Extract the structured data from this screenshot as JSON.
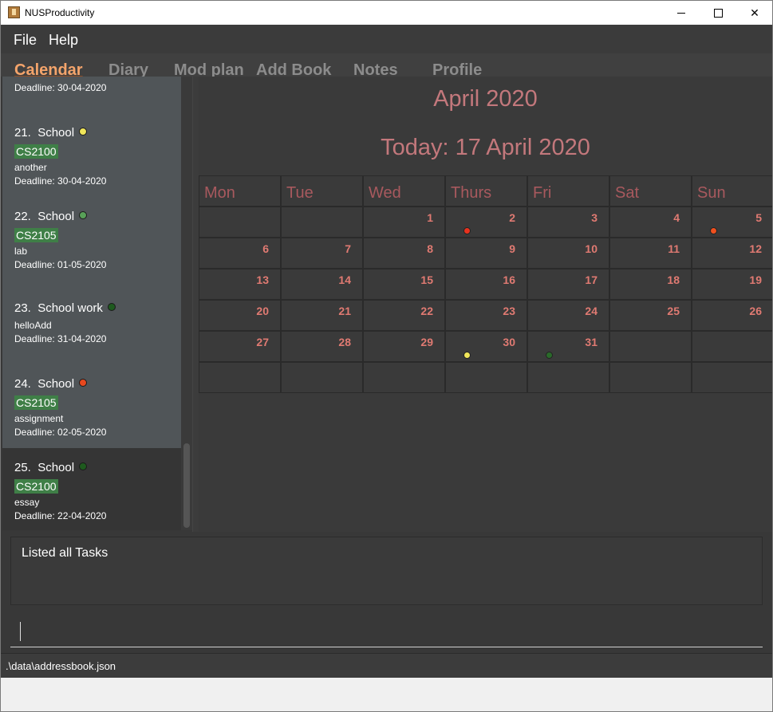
{
  "window": {
    "title": "NUSProductivity"
  },
  "menu": {
    "file": "File",
    "help": "Help"
  },
  "tabs": [
    "Calendar",
    "Diary",
    "Mod plan",
    "Add Book",
    "Notes",
    "Profile"
  ],
  "tasks": [
    {
      "partial_text": "Deadline: 30-04-2020"
    },
    {
      "index": "21.",
      "type": "School",
      "status_color": "#f0e65a",
      "module": "CS2100",
      "description": "another",
      "deadline": "Deadline: 30-04-2020"
    },
    {
      "index": "22.",
      "type": "School",
      "status_color": "#58a058",
      "module": "CS2105",
      "description": "lab",
      "deadline": "Deadline: 01-05-2020"
    },
    {
      "index": "23.",
      "type": "School work",
      "status_color": "#1e5a1e",
      "module": "",
      "description": "helloAdd",
      "deadline": "Deadline: 31-04-2020"
    },
    {
      "index": "24.",
      "type": "School",
      "status_color": "#e8481e",
      "module": "CS2105",
      "description": "assignment",
      "deadline": "Deadline: 02-05-2020"
    },
    {
      "index": "25.",
      "type": "School",
      "status_color": "#1e5a1e",
      "module": "CS2100",
      "description": "essay",
      "deadline": "Deadline: 22-04-2020"
    }
  ],
  "calendar": {
    "month_title": "April 2020",
    "today": "Today: 17 April 2020",
    "weekdays": [
      "Mon",
      "Tue",
      "Wed",
      "Thurs",
      "Fri",
      "Sat",
      "Sun"
    ],
    "weeks": [
      [
        "",
        "",
        "1",
        "2",
        "3",
        "4",
        "5"
      ],
      [
        "6",
        "7",
        "8",
        "9",
        "10",
        "11",
        "12"
      ],
      [
        "13",
        "14",
        "15",
        "16",
        "17",
        "18",
        "19"
      ],
      [
        "20",
        "21",
        "22",
        "23",
        "24",
        "25",
        "26"
      ],
      [
        "27",
        "28",
        "29",
        "30",
        "31",
        "",
        ""
      ],
      [
        "",
        "",
        "",
        "",
        "",
        "",
        ""
      ]
    ],
    "markers": [
      {
        "week": 0,
        "day": 3,
        "color": "#e8321e"
      },
      {
        "week": 0,
        "day": 6,
        "color": "#f0501e"
      },
      {
        "week": 4,
        "day": 3,
        "color": "#f0e65a"
      },
      {
        "week": 4,
        "day": 4,
        "color": "#2a6a2a"
      }
    ]
  },
  "result": {
    "text": "Listed all Tasks"
  },
  "status": {
    "path": ".\\data\\addressbook.json"
  }
}
